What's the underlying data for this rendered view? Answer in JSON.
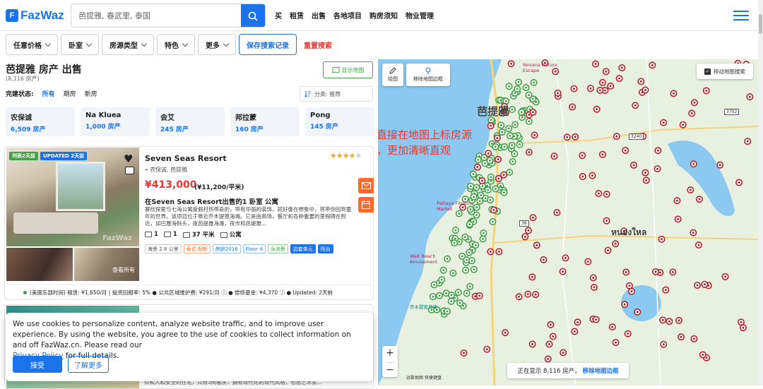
{
  "header": {
    "logo": "FazWaz",
    "search_placeholder": "芭提雅, 春武里, 泰国",
    "nav": [
      "买",
      "租赁",
      "出售",
      "各地项目",
      "购房须知",
      "物业管理"
    ]
  },
  "filters": {
    "items": [
      "任意价格",
      "卧室",
      "房源类型",
      "特色",
      "更多"
    ],
    "save": "保存搜索记录",
    "reset": "重置搜索"
  },
  "list": {
    "title": "芭提雅 房产 出售",
    "count": "(8,116 房产)",
    "show_map": "显示地图",
    "status_label": "完建状态:",
    "status_options": [
      "所有",
      "期房",
      "新房"
    ],
    "sort": "分类: 推荐",
    "areas": [
      {
        "name": "农保诚",
        "count": "6,509 房产"
      },
      {
        "name": "Na Kluea",
        "count": "1,000 房产"
      },
      {
        "name": "会艾",
        "count": "245 房产"
      },
      {
        "name": "邦拉蒙",
        "count": "160 房产"
      },
      {
        "name": "Pong",
        "count": "145 房产"
      }
    ]
  },
  "card": {
    "badge1": "列表2天前",
    "badge2": "UPDATED 2天前",
    "watermark": "FazWaz",
    "view_all": "查看所有",
    "title": "Seven Seas Resort",
    "rating": 4,
    "location": "农保诚, 芭提雅",
    "price": "¥413,000",
    "price_sqm": "(¥11,200/平米)",
    "subtitle": "在Seven Seas Resort出售的1 卧室 公寓",
    "description": "赛欣探索与七海公寓度假村热带奇的，带有华丽的装饰，就好像在想象中，将带你回到童年的世界。该项目位于靠近乔木提恩海滩。它是由商场，餐厅和各种重要的里程碑在附近，如巴厘海码头，南芭提雅海滩，夜市和芭堤雅...",
    "specs": [
      "1",
      "1",
      "37 平米",
      "公寓"
    ],
    "tags": [
      "海景 2.8 公里",
      "泰式 配额",
      "房龄2016",
      "Floor 4",
      "泳池景",
      "边套单元",
      "阳台"
    ],
    "footer": "(美国东部时间)  租赁: ¥1,650/月 | 投资回报率: 5%  ●  公共区域维护费: ¥291/月 ⓘ  ●  偿债基金: ¥4,370 ⓘ  ●  Updated: 2天前"
  },
  "card2": {
    "line": "供私人和安全的住宅，共有3间客房，拥有现代化的现代风格，包括艺术家..."
  },
  "cookie": {
    "text": "We use cookies to personalize content, analyze website traffic, and to improve user experience. By using the website, you agree to the use of cookies to collect information on and off FazWaz.cn. Please read our",
    "link": "Privacy Policy",
    "text_end": " for full details.",
    "accept": "接受",
    "learn_more": "了解更多"
  },
  "map": {
    "draw": "绘图",
    "remove_bounds": "移除地图边框",
    "move_search": "移动地图搜索",
    "city_label": "芭提雅",
    "east_label": "หนองใหล",
    "annotation": "直接在地图上标房源\n，更加清晰直观",
    "status_prefix": "正在显示 8,116 房产，",
    "status_link": "移除地图边框",
    "legal": "谷歌地图   快捷键盘",
    "poi": [
      "Nevana Nature Escape",
      "Pattaya Floating Market",
      "Walt Beach Amusement",
      "乔木提恩海滩"
    ],
    "road_labels": [
      "3702",
      "3240",
      "36"
    ],
    "colors": {
      "sea": "#8cc9f0",
      "land": "#e8f0e0",
      "red_pin": "#b3202a",
      "green_pin": "#43a047"
    }
  }
}
